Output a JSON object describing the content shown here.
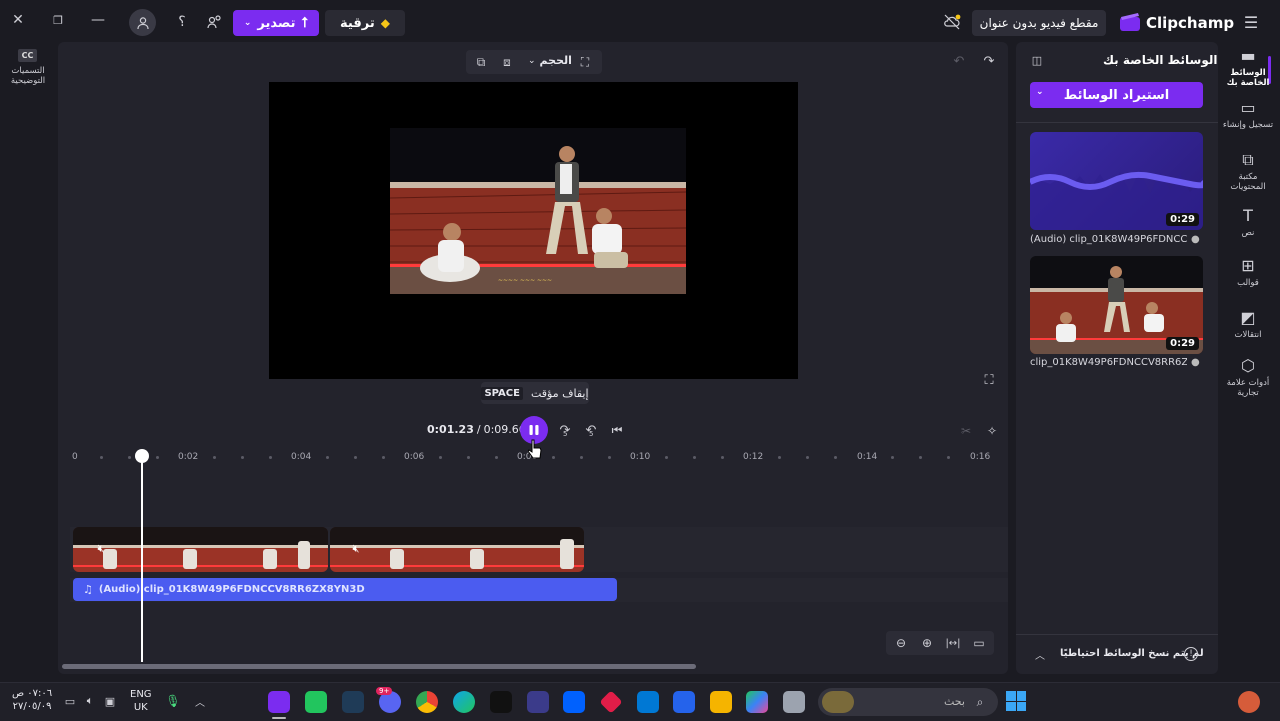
{
  "app": {
    "name": "Clipchamp",
    "project_title": "مقطع فيديو بدون عنوان"
  },
  "topbar": {
    "upgrade_label": "ترقية",
    "export_label": "تصدير",
    "help_label": "؟"
  },
  "left": {
    "captions_short": "CC",
    "captions_label": "التسميات التوضيحية"
  },
  "stage": {
    "size_label": "الحجم",
    "tooltip_label": "إيقاف مؤقت",
    "tooltip_key": "SPACE",
    "current_time": "0:01.23",
    "separator": "/",
    "total_time": "0:09.66",
    "skip_back_label": "5",
    "skip_fwd_label": "5",
    "ticks": [
      "0",
      "0:02",
      "0:04",
      "0:06",
      "0:08",
      "0:10",
      "0:12",
      "0:14",
      "0:16"
    ],
    "audio_track_label": "(Audio) clip_01K8W49P6FDNCCV8RR6ZX8YN3D",
    "playhead_fraction": 0.128
  },
  "media_panel": {
    "title": "الوسائط الخاصة بك",
    "import_label": "استيراد الوسائط",
    "items": [
      {
        "name": "(Audio) clip_01K8W49P6FDNCCV8...",
        "duration": "0:29"
      },
      {
        "name": "clip_01K8W49P6FDNCCV8RR6ZX8Y...",
        "duration": "0:29"
      }
    ],
    "backup_notice": "لم يتم نسخ الوسائط احتياطيًا"
  },
  "rail": [
    {
      "label": "الوسائط الخاصة بك",
      "icon": "folder-icon"
    },
    {
      "label": "تسجيل وإنشاء",
      "icon": "camera-icon"
    },
    {
      "label": "مكتبة المحتويات",
      "icon": "library-icon"
    },
    {
      "label": "نص",
      "icon": "text-icon"
    },
    {
      "label": "قوالب",
      "icon": "templates-icon"
    },
    {
      "label": "انتقالات",
      "icon": "transitions-icon"
    },
    {
      "label": "أدوات علامة تجارية",
      "icon": "brand-icon"
    }
  ],
  "taskbar": {
    "search_placeholder": "بحث",
    "lang_top": "ENG",
    "lang_bottom": "UK",
    "time": "٠٧:٠٦ ص",
    "date": "٢٧/٠٥/٠٩",
    "discord_badge": "9+"
  },
  "colors": {
    "accent": "#7b2cf0",
    "audio_track": "#4b5cf0",
    "bg": "#1b1b22",
    "panel": "#23232c"
  }
}
